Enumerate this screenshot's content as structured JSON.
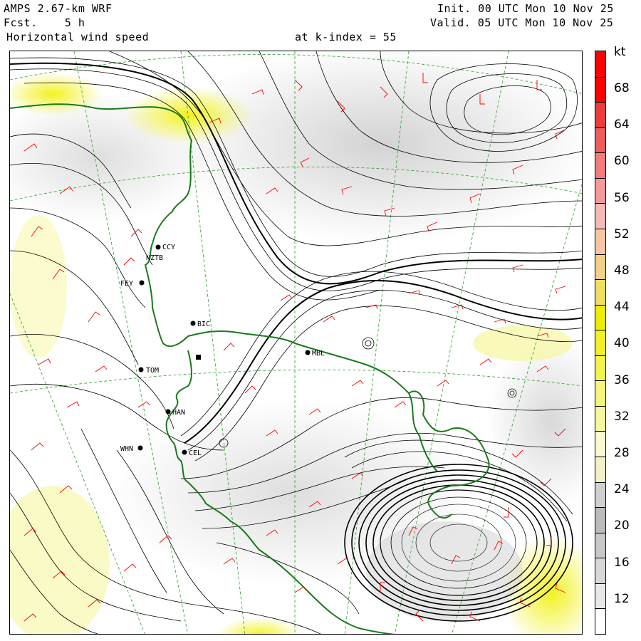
{
  "header": {
    "model": "AMPS 2.67-km WRF",
    "fcst_label": "Fcst.",
    "fcst_value": "5 h",
    "field": "Horizontal wind speed",
    "level": "at k-index = 55",
    "init": "Init. 00 UTC Mon 10 Nov 25",
    "valid": "Valid. 05 UTC Mon 10 Nov 25"
  },
  "colorbar": {
    "unit": "kt",
    "labels": [
      "68",
      "64",
      "60",
      "56",
      "52",
      "48",
      "44",
      "40",
      "36",
      "32",
      "28",
      "24",
      "20",
      "16",
      "12"
    ],
    "colors": [
      "#ffffff",
      "#e8e8e8",
      "#d8d8d8",
      "#c8c8c8",
      "#bbbbbb",
      "#d0d0d0",
      "#f2f2c6",
      "#fafad0",
      "#f7f7a0",
      "#f5f57a",
      "#f4f44c",
      "#f2f222",
      "#eeee00",
      "#f0e060",
      "#f2d08a",
      "#f7c7a3",
      "#f7b8b8",
      "#f59a9a",
      "#f37c7c",
      "#f05c5c",
      "#ee3c3c",
      "#ff0000",
      "#ff0000"
    ]
  },
  "stations": [
    {
      "id": "CCY",
      "label": "CCY"
    },
    {
      "id": "NZTB",
      "label": "NZTB"
    },
    {
      "id": "FEY",
      "label": "FEY"
    },
    {
      "id": "BIC",
      "label": "BIC"
    },
    {
      "id": "MBL",
      "label": "MBL"
    },
    {
      "id": "TOM",
      "label": "TOM"
    },
    {
      "id": "HAN",
      "label": "HAN"
    },
    {
      "id": "WHN",
      "label": "WHN"
    },
    {
      "id": "CEL",
      "label": "CEL"
    }
  ],
  "colors": {
    "coastline": "#1a7a1a",
    "barb": "#ff0000",
    "grid": "#2aa02a",
    "streamline": "#000000"
  }
}
